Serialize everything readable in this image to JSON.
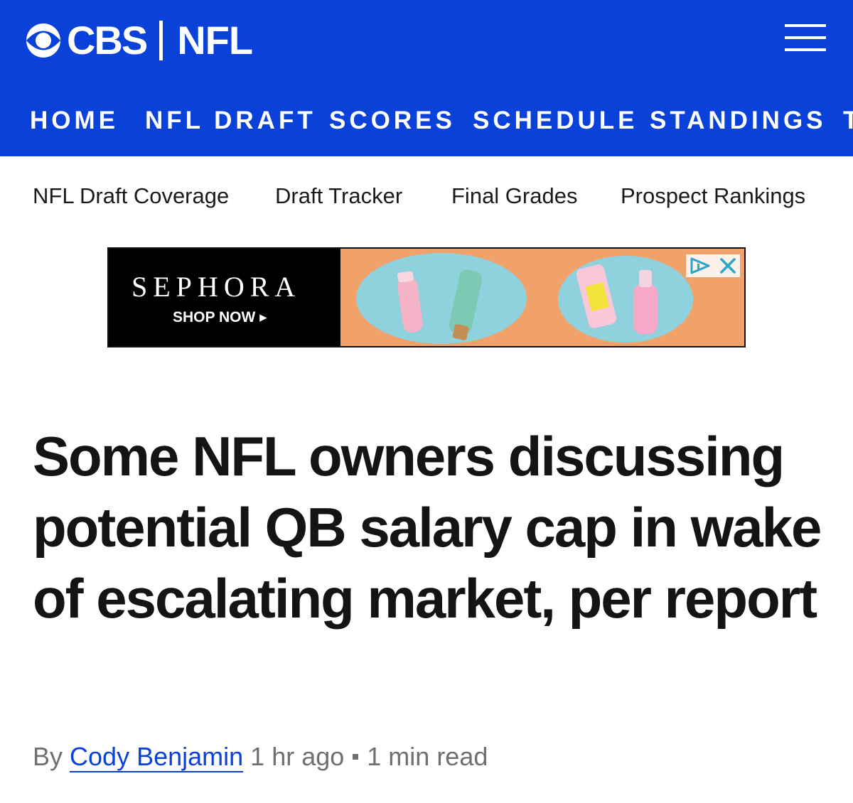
{
  "header": {
    "brand_cbs": "CBS",
    "brand_section": "NFL",
    "brand_color": "#0a41d8",
    "menu_icon": "hamburger-menu-icon"
  },
  "main_nav": [
    "HOME",
    "NFL DRAFT",
    "SCORES",
    "SCHEDULE",
    "STANDINGS",
    "T"
  ],
  "sub_nav": [
    "NFL Draft Coverage",
    "Draft Tracker",
    "Final Grades",
    "Prospect Rankings"
  ],
  "ad": {
    "brand": "SEPHORA",
    "cta": "SHOP NOW ▸",
    "adchoices_icon": "adchoices-icon",
    "close_icon": "close-icon"
  },
  "article": {
    "headline": "Some NFL owners discussing potential QB salary cap in wake of escalating market, per report",
    "byline_prefix": "By",
    "author": "Cody Benjamin",
    "time_ago": "1 hr ago",
    "read_time": "1 min read"
  }
}
